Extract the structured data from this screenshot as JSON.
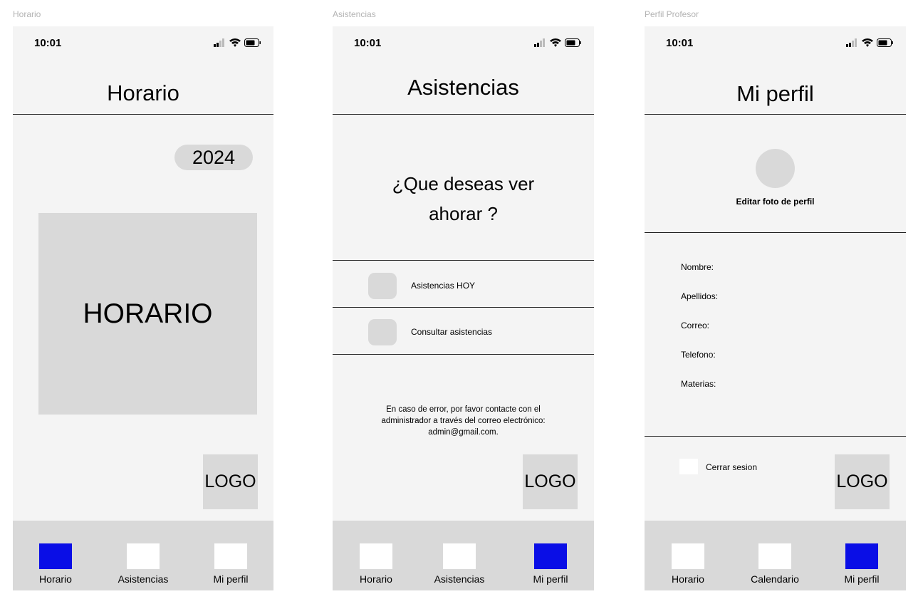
{
  "frames": {
    "horario": {
      "frame_label": "Horario",
      "time": "10:01",
      "title": "Horario",
      "year": "2024",
      "schedule_placeholder": "HORARIO",
      "logo": "LOGO",
      "nav": [
        "Horario",
        "Asistencias",
        "Mi perfil"
      ]
    },
    "asistencias": {
      "frame_label": "Asistencias",
      "time": "10:01",
      "title": "Asistencias",
      "question_line1": "¿Que deseas ver",
      "question_line2": "ahorar ?",
      "option_today": "Asistencias HOY",
      "option_consult": "Consultar asistencias",
      "error_line1": "En caso de error, por favor contacte con el",
      "error_line2": "administrador a través del correo electrónico:",
      "error_line3": "admin@gmail.com.",
      "logo": "LOGO",
      "nav": [
        "Horario",
        "Asistencias",
        "Mi perfil"
      ]
    },
    "perfil": {
      "frame_label": "Perfil Profesor",
      "time": "10:01",
      "title": "Mi perfil",
      "edit_photo": "Editar foto de perfil",
      "fields": [
        "Nombre:",
        "Apellidos:",
        "Correo:",
        "Telefono:",
        "Materias:"
      ],
      "logout": "Cerrar sesion",
      "logo": "LOGO",
      "nav": [
        "Horario",
        "Calendario",
        "Mi perfil"
      ]
    }
  },
  "colors": {
    "screen_bg": "#f4f4f4",
    "placeholder_gray": "#d9d9d9",
    "active_nav": "#0a0ee6"
  },
  "icons": [
    "signal-icon",
    "wifi-icon",
    "battery-icon"
  ]
}
